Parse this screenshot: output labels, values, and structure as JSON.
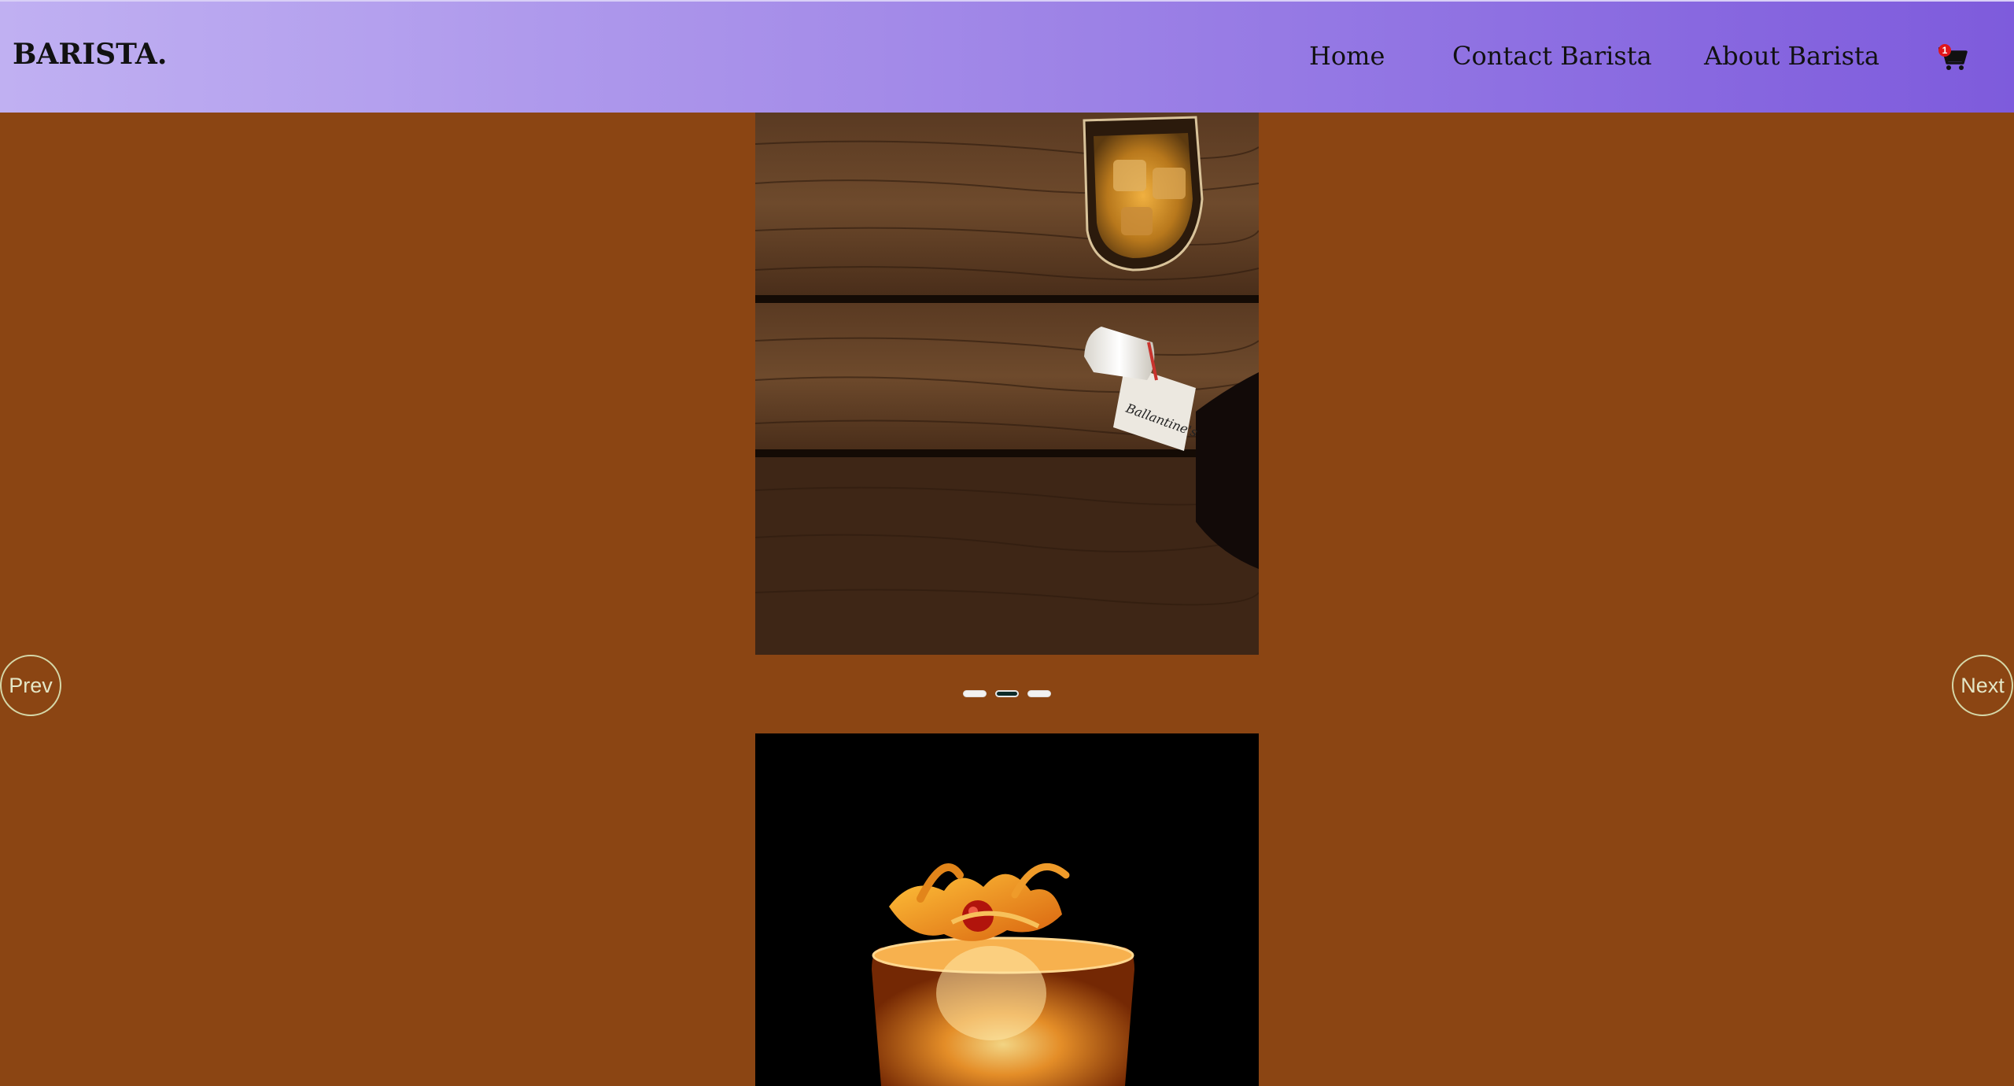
{
  "brand": {
    "name": "BARISTA."
  },
  "nav": {
    "items": [
      {
        "label": "Home"
      },
      {
        "label": "Contact Barista"
      },
      {
        "label": "About Barista"
      }
    ],
    "cart": {
      "count": "1",
      "icon": "shopping-cart-icon"
    }
  },
  "slider": {
    "prev_label": "Prev",
    "next_label": "Next",
    "dots": 3,
    "active_dot": 2
  },
  "colors": {
    "page_background": "#8b4513",
    "header_gradient_start": "#c0b0f2",
    "header_gradient_end": "#7e5bdc",
    "cart_badge": "#e0161b",
    "button_outline": "#d5d7a8"
  }
}
